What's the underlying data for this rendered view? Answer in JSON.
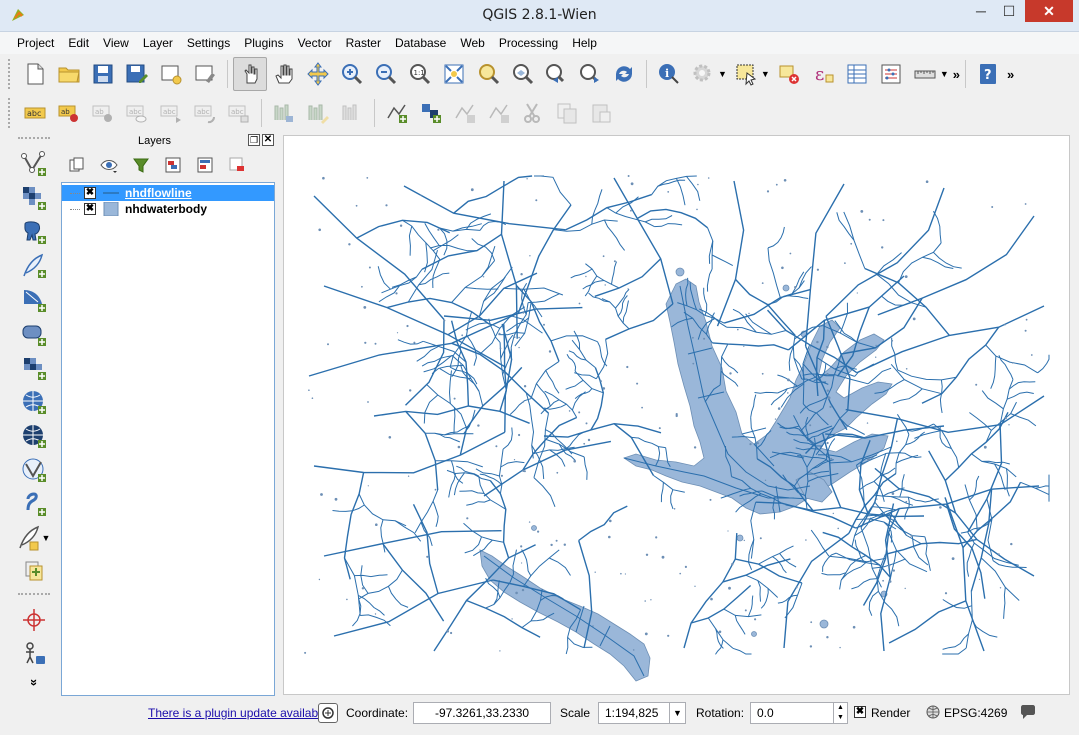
{
  "window": {
    "title": "QGIS 2.8.1-Wien"
  },
  "menu": [
    "Project",
    "Edit",
    "View",
    "Layer",
    "Settings",
    "Plugins",
    "Vector",
    "Raster",
    "Database",
    "Web",
    "Processing",
    "Help"
  ],
  "layers_panel": {
    "title": "Layers",
    "layers": [
      {
        "name": "nhdflowline",
        "checked": true,
        "selected": true,
        "type": "line"
      },
      {
        "name": "nhdwaterbody",
        "checked": true,
        "selected": false,
        "type": "polygon"
      }
    ]
  },
  "statusbar": {
    "plugin_update_link": "There is a plugin update available",
    "coordinate_label": "Coordinate:",
    "coordinate_value": "-97.3261,33.2330",
    "scale_label": "Scale",
    "scale_value": "1:194,825",
    "rotation_label": "Rotation:",
    "rotation_value": "0.0",
    "render_label": "Render",
    "render_checked": true,
    "crs": "EPSG:4269"
  },
  "colors": {
    "flowline": "#2b6fad",
    "waterbody": "#9ab7d9",
    "selection": "#3399ff"
  }
}
